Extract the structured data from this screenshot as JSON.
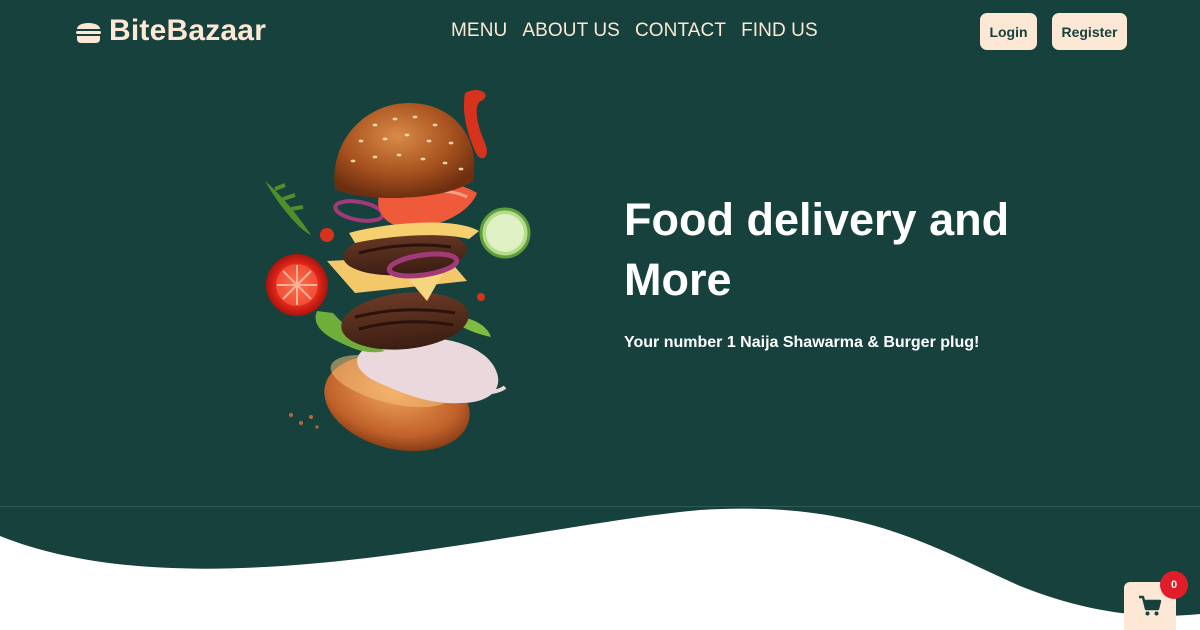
{
  "brand": {
    "name": "BiteBazaar",
    "icon": "burger-icon"
  },
  "nav": {
    "items": [
      {
        "label": "MENU"
      },
      {
        "label": "ABOUT US"
      },
      {
        "label": "CONTACT"
      },
      {
        "label": "FIND US"
      }
    ]
  },
  "auth": {
    "login_label": "Login",
    "register_label": "Register"
  },
  "hero": {
    "title_line1": "Food delivery and",
    "title_line2": "More",
    "subtitle": "Your number 1 Naija Shawarma & Burger plug!"
  },
  "cart": {
    "icon": "cart-icon",
    "count": "0"
  },
  "colors": {
    "background": "#17413c",
    "accent": "#fde8d6",
    "badge": "#e11d2a"
  }
}
